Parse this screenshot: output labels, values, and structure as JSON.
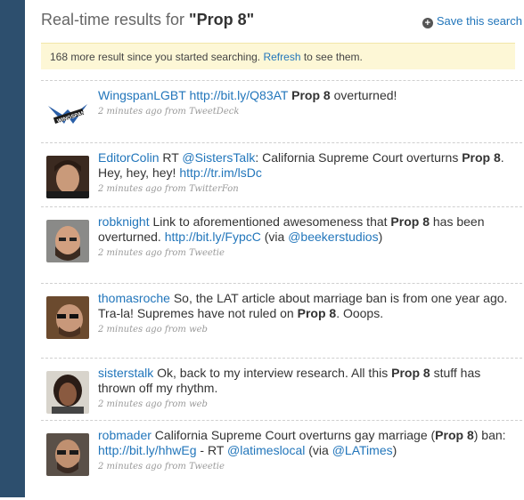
{
  "header": {
    "title_prefix": "Real-time results for ",
    "query": "\"Prop 8\"",
    "save_label": "Save this search",
    "save_icon": "plus-circle-icon"
  },
  "notice": {
    "text_before": "168 more result since you started searching. ",
    "refresh_label": "Refresh",
    "text_after": " to see them."
  },
  "tweets": [
    {
      "user": "WingspanLGBT",
      "parts": [
        " ",
        {
          "link": "http://bit.ly/Q83AT"
        },
        " ",
        {
          "bold": "Prop 8"
        },
        " overturned!"
      ],
      "time": "2 minutes ago from TweetDeck"
    },
    {
      "user": "EditorColin",
      "parts": [
        " RT ",
        {
          "link": "@SistersTalk"
        },
        ": California Supreme Court overturns ",
        {
          "bold": "Prop 8"
        },
        ". Hey, hey, hey! ",
        {
          "link": "http://tr.im/lsDc"
        }
      ],
      "time": "2 minutes ago from TwitterFon"
    },
    {
      "user": "robknight",
      "parts": [
        " Link to aforementioned awesomeness that ",
        {
          "bold": "Prop 8"
        },
        " has been overturned. ",
        {
          "link": "http://bit.ly/FypcC"
        },
        " (via ",
        {
          "link": "@beekerstudios"
        },
        ")"
      ],
      "time": "2 minutes ago from Tweetie"
    },
    {
      "user": "thomasroche",
      "parts": [
        " So, the LAT article about marriage ban is from one year ago. Tra-la! Supremes have not ruled on ",
        {
          "bold": "Prop 8"
        },
        ". Ooops."
      ],
      "time": "2 minutes ago from web"
    },
    {
      "user": "sisterstalk",
      "parts": [
        " Ok, back to my interview research. All this ",
        {
          "bold": "Prop 8"
        },
        " stuff has thrown off my rhythm."
      ],
      "time": "2 minutes ago from web"
    },
    {
      "user": "robmader",
      "parts": [
        " California Supreme Court overturns gay marriage (",
        {
          "bold": "Prop 8"
        },
        ") ban: ",
        {
          "link": "http://bit.ly/hhwEg"
        },
        " - RT ",
        {
          "link": "@latimeslocal"
        },
        " (via ",
        {
          "link": "@LATimes"
        },
        ")"
      ],
      "time": "2 minutes ago from Tweetie"
    }
  ]
}
